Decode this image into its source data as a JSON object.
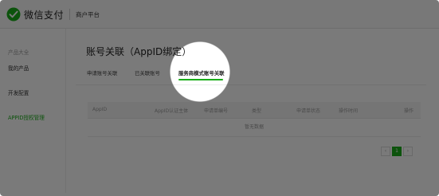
{
  "header": {
    "brand": "微信支付",
    "platform": "商户平台"
  },
  "sidebar": {
    "items": [
      {
        "label": "产品大全"
      },
      {
        "label": "我的产品"
      },
      {
        "label": "开发配置"
      },
      {
        "label": "APPID授权管理"
      }
    ]
  },
  "main": {
    "title": "账号关联（AppID绑定）",
    "tabs": [
      {
        "label": "申请账号关联"
      },
      {
        "label": "已关联账号"
      },
      {
        "label": "服务商模式账号关联"
      }
    ],
    "table": {
      "columns": [
        "AppID",
        "AppID认证主体",
        "申请单编号",
        "类型",
        "申请单状态",
        "操作时间",
        "操作"
      ],
      "empty_text": "暂无数据"
    },
    "pagination": {
      "prev": "‹",
      "current": "1",
      "next": "›"
    }
  },
  "colors": {
    "brand_green": "#1aad19"
  }
}
